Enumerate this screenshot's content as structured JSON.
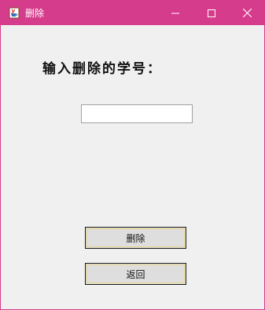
{
  "window": {
    "title": "删除",
    "app_icon": "java-cup-icon",
    "controls": [
      "minimize-icon",
      "maximize-icon",
      "close-icon"
    ],
    "title_bar_color": "#d63c8c"
  },
  "form": {
    "prompt_label": "输入删除的学号：",
    "student_id_value": "",
    "delete_label": "删除",
    "back_label": "返回"
  }
}
